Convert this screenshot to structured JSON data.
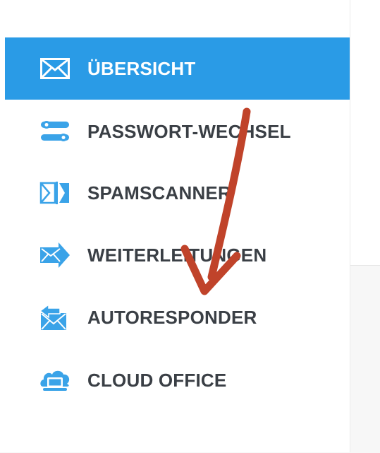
{
  "sidebar": {
    "items": [
      {
        "label": "ÜBERSICHT",
        "icon": "envelope-icon",
        "active": true
      },
      {
        "label": "PASSWORT-WECHSEL",
        "icon": "password-toggle-icon",
        "active": false
      },
      {
        "label": "SPAMSCANNER",
        "icon": "spam-filter-icon",
        "active": false
      },
      {
        "label": "WEITERLEITUNGEN",
        "icon": "forward-mail-icon",
        "active": false
      },
      {
        "label": "AUTORESPONDER",
        "icon": "reply-mail-icon",
        "active": false
      },
      {
        "label": "CLOUD OFFICE",
        "icon": "cloud-computer-icon",
        "active": false
      }
    ]
  },
  "colors": {
    "accent": "#2a9be6",
    "icon_blue": "#3aa3e8",
    "text": "#3a3f45",
    "annotation_arrow": "#c0432a"
  }
}
